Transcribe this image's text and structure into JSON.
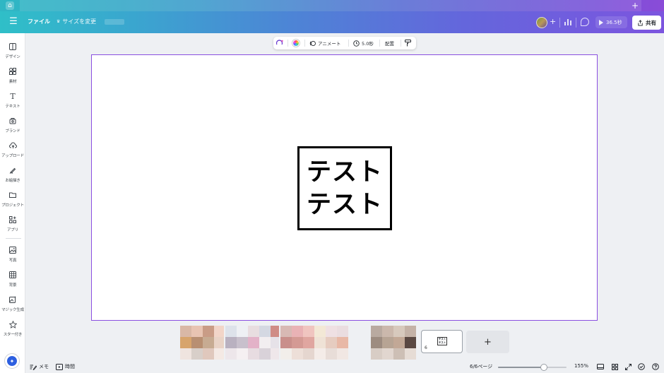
{
  "header": {
    "file_label": "ファイル",
    "resize_label": "サイズを変更",
    "play_label": "36.5秒",
    "share_label": "共有"
  },
  "sidebar": {
    "items": [
      {
        "label": "デザイン",
        "icon": "layout-icon"
      },
      {
        "label": "素材",
        "icon": "elements-icon"
      },
      {
        "label": "テキスト",
        "icon": "text-icon"
      },
      {
        "label": "ブランド",
        "icon": "brand-icon"
      },
      {
        "label": "アップロード",
        "icon": "upload-cloud-icon"
      },
      {
        "label": "お絵描き",
        "icon": "draw-icon"
      },
      {
        "label": "プロジェクト",
        "icon": "folder-icon"
      },
      {
        "label": "アプリ",
        "icon": "apps-icon"
      },
      {
        "label": "写真",
        "icon": "photo-icon"
      },
      {
        "label": "背景",
        "icon": "background-icon"
      },
      {
        "label": "マジック生成",
        "icon": "magic-media-icon"
      },
      {
        "label": "スター付き",
        "icon": "star-icon"
      }
    ]
  },
  "floating_toolbar": {
    "animate_label": "アニメート",
    "duration_label": "5.0秒",
    "position_label": "配置"
  },
  "canvas": {
    "text_line1": "テスト",
    "text_line2": "テスト"
  },
  "pages": {
    "current_number": "6",
    "mini_text1": "テスト",
    "mini_text2": "テスト"
  },
  "bottom": {
    "notes_label": "メモ",
    "timer_label": "時間",
    "page_indicator": "6/6ページ",
    "zoom_label": "155%",
    "zoom_fraction": 0.67
  },
  "colors": {
    "accent": "#8a4fe0",
    "header_start": "#2fbfc8",
    "header_end": "#7c55df"
  }
}
